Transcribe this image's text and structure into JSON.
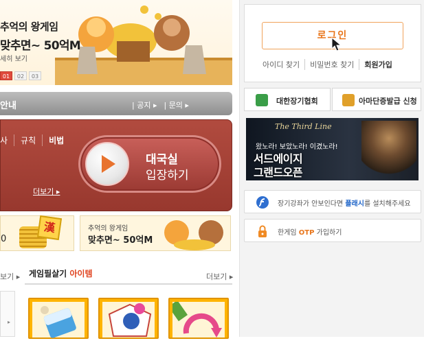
{
  "banner": {
    "title": "추억의 왕게임",
    "subtitle": "맞추면~ 50억M",
    "detail": "세히 보기",
    "pager": [
      "01",
      "02",
      "03"
    ]
  },
  "notice": {
    "title": "안내",
    "links": [
      "공지",
      "문의"
    ]
  },
  "game_panel": {
    "tabs": [
      "사",
      "규칙",
      "비법"
    ],
    "more": "더보기",
    "enter_line1": "대국실",
    "enter_line2": "입장하기"
  },
  "promo": {
    "left_text": "0",
    "han_char": "漢",
    "right_line1": "추억의 왕게임",
    "right_line2": "맞추면~ 50억M"
  },
  "items_section": {
    "left_more": "보기",
    "title_plain": "게임필살기",
    "title_highlight": "아이템",
    "more": "더보기"
  },
  "login": {
    "button_label": "로그인",
    "links": [
      "아이디 찾기",
      "비밀번호 찾기",
      "회원가입"
    ]
  },
  "quick_buttons": [
    {
      "label": "대한장기협회"
    },
    {
      "label": "아마단증발급 신청"
    }
  ],
  "ad": {
    "logo": "The Third Line",
    "line1": "왔노라! 보았노라! 이겼노라!",
    "line2": "서드에이지",
    "line3": "그랜드오픈"
  },
  "info_rows": {
    "flash_pre": "장기강좌가 안보인다면 ",
    "flash_hl": "플래시",
    "flash_post": "를 설치해주세요",
    "otp_pre": "한게임 ",
    "otp_hl": "OTP",
    "otp_post": " 가입하기"
  },
  "colors": {
    "accent_orange": "#e8751a",
    "panel_red": "#a8443a",
    "link_blue": "#1e64c8"
  }
}
